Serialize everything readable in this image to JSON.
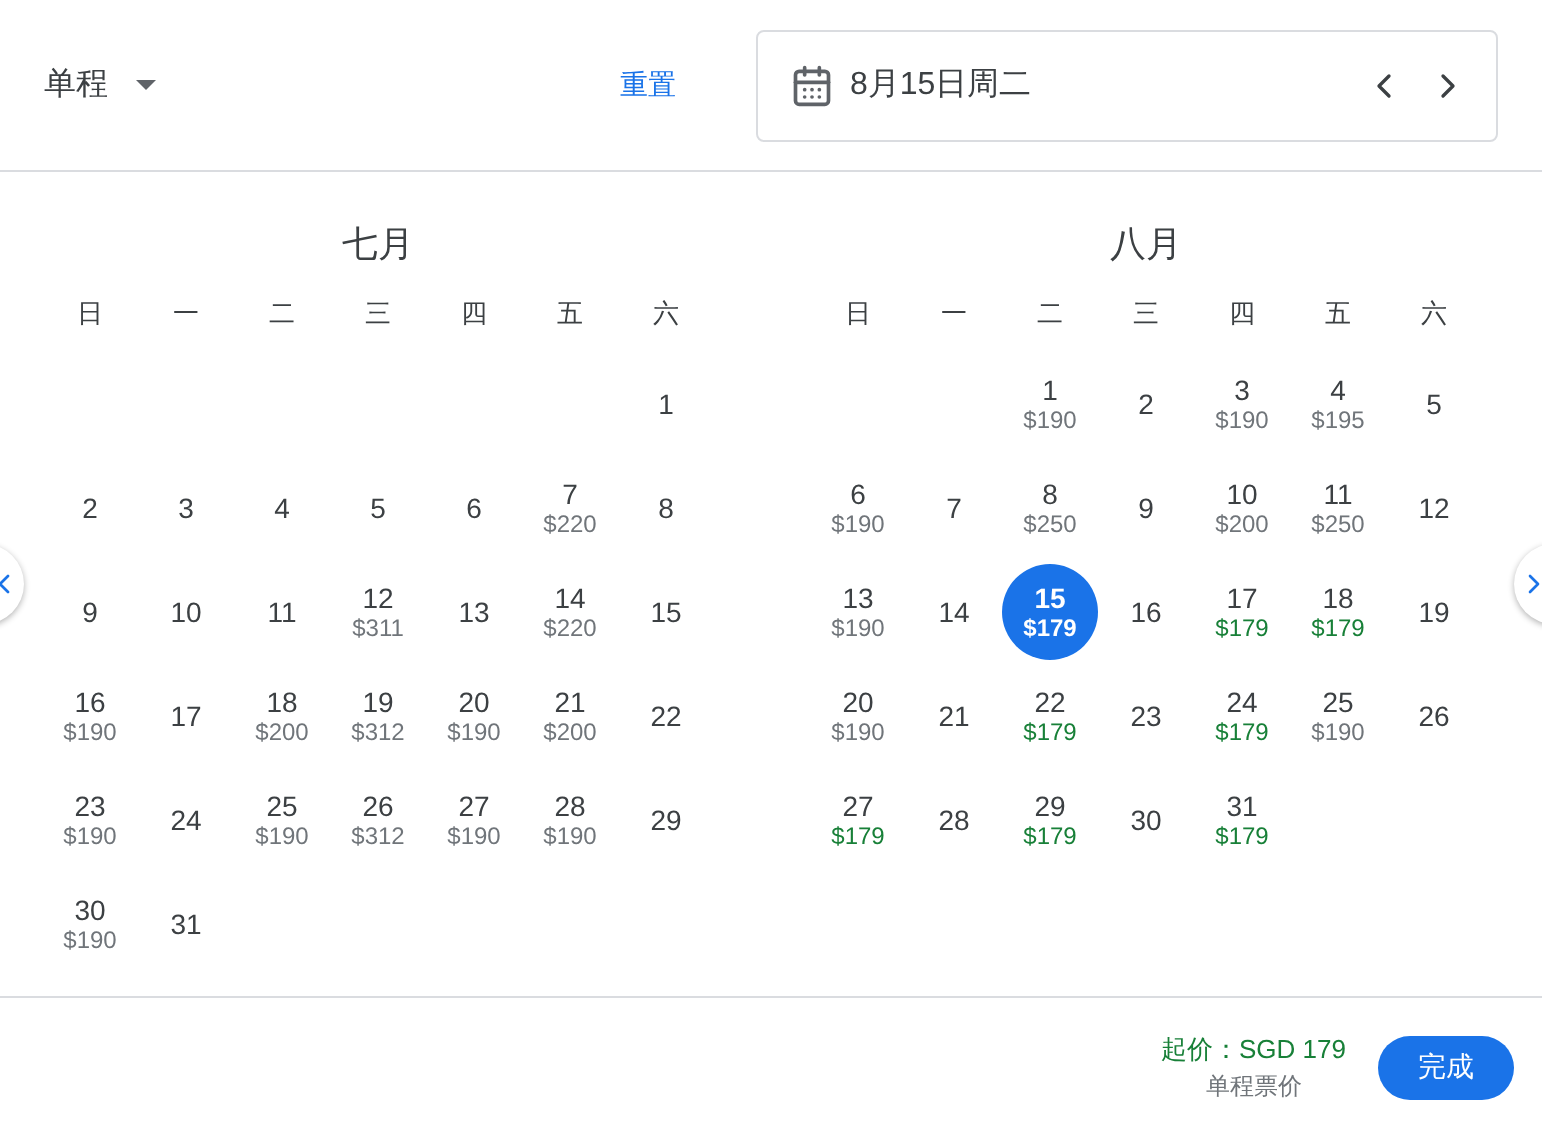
{
  "header": {
    "trip_type": "单程",
    "reset": "重置",
    "date_field": {
      "value": "8月15日周二"
    }
  },
  "months": [
    {
      "title": "七月",
      "weekdays": [
        "日",
        "一",
        "二",
        "三",
        "四",
        "五",
        "六"
      ],
      "weeks": [
        [
          {
            "kind": "blank"
          },
          {
            "kind": "blank"
          },
          {
            "kind": "blank"
          },
          {
            "kind": "blank"
          },
          {
            "kind": "blank"
          },
          {
            "kind": "blank"
          },
          {
            "kind": "day",
            "day": "1",
            "selected": false
          }
        ],
        [
          {
            "kind": "day",
            "day": "2",
            "selected": false
          },
          {
            "kind": "day",
            "day": "3",
            "selected": false
          },
          {
            "kind": "day",
            "day": "4",
            "selected": false
          },
          {
            "kind": "day",
            "day": "5",
            "selected": false
          },
          {
            "kind": "day",
            "day": "6",
            "selected": false
          },
          {
            "kind": "day",
            "day": "7",
            "price": "$220",
            "lowest": false,
            "selected": false
          },
          {
            "kind": "day",
            "day": "8",
            "selected": false
          }
        ],
        [
          {
            "kind": "day",
            "day": "9",
            "selected": false
          },
          {
            "kind": "day",
            "day": "10",
            "selected": false
          },
          {
            "kind": "day",
            "day": "11",
            "selected": false
          },
          {
            "kind": "day",
            "day": "12",
            "price": "$311",
            "lowest": false,
            "selected": false
          },
          {
            "kind": "day",
            "day": "13",
            "selected": false
          },
          {
            "kind": "day",
            "day": "14",
            "price": "$220",
            "lowest": false,
            "selected": false
          },
          {
            "kind": "day",
            "day": "15",
            "selected": false
          }
        ],
        [
          {
            "kind": "day",
            "day": "16",
            "price": "$190",
            "lowest": false,
            "selected": false
          },
          {
            "kind": "day",
            "day": "17",
            "selected": false
          },
          {
            "kind": "day",
            "day": "18",
            "price": "$200",
            "lowest": false,
            "selected": false
          },
          {
            "kind": "day",
            "day": "19",
            "price": "$312",
            "lowest": false,
            "selected": false
          },
          {
            "kind": "day",
            "day": "20",
            "price": "$190",
            "lowest": false,
            "selected": false
          },
          {
            "kind": "day",
            "day": "21",
            "price": "$200",
            "lowest": false,
            "selected": false
          },
          {
            "kind": "day",
            "day": "22",
            "selected": false
          }
        ],
        [
          {
            "kind": "day",
            "day": "23",
            "price": "$190",
            "lowest": false,
            "selected": false
          },
          {
            "kind": "day",
            "day": "24",
            "selected": false
          },
          {
            "kind": "day",
            "day": "25",
            "price": "$190",
            "lowest": false,
            "selected": false
          },
          {
            "kind": "day",
            "day": "26",
            "price": "$312",
            "lowest": false,
            "selected": false
          },
          {
            "kind": "day",
            "day": "27",
            "price": "$190",
            "lowest": false,
            "selected": false
          },
          {
            "kind": "day",
            "day": "28",
            "price": "$190",
            "lowest": false,
            "selected": false
          },
          {
            "kind": "day",
            "day": "29",
            "selected": false
          }
        ],
        [
          {
            "kind": "day",
            "day": "30",
            "price": "$190",
            "lowest": false,
            "selected": false
          },
          {
            "kind": "day",
            "day": "31",
            "selected": false
          }
        ]
      ]
    },
    {
      "title": "八月",
      "weekdays": [
        "日",
        "一",
        "二",
        "三",
        "四",
        "五",
        "六"
      ],
      "weeks": [
        [
          {
            "kind": "blank"
          },
          {
            "kind": "blank"
          },
          {
            "kind": "day",
            "day": "1",
            "price": "$190",
            "lowest": false,
            "selected": false
          },
          {
            "kind": "day",
            "day": "2",
            "selected": false
          },
          {
            "kind": "day",
            "day": "3",
            "price": "$190",
            "lowest": false,
            "selected": false
          },
          {
            "kind": "day",
            "day": "4",
            "price": "$195",
            "lowest": false,
            "selected": false
          },
          {
            "kind": "day",
            "day": "5",
            "selected": false
          }
        ],
        [
          {
            "kind": "day",
            "day": "6",
            "price": "$190",
            "lowest": false,
            "selected": false
          },
          {
            "kind": "day",
            "day": "7",
            "selected": false
          },
          {
            "kind": "day",
            "day": "8",
            "price": "$250",
            "lowest": false,
            "selected": false
          },
          {
            "kind": "day",
            "day": "9",
            "selected": false
          },
          {
            "kind": "day",
            "day": "10",
            "price": "$200",
            "lowest": false,
            "selected": false
          },
          {
            "kind": "day",
            "day": "11",
            "price": "$250",
            "lowest": false,
            "selected": false
          },
          {
            "kind": "day",
            "day": "12",
            "selected": false
          }
        ],
        [
          {
            "kind": "day",
            "day": "13",
            "price": "$190",
            "lowest": false,
            "selected": false
          },
          {
            "kind": "day",
            "day": "14",
            "selected": false
          },
          {
            "kind": "day",
            "day": "15",
            "price": "$179",
            "selected": true
          },
          {
            "kind": "day",
            "day": "16",
            "selected": false
          },
          {
            "kind": "day",
            "day": "17",
            "price": "$179",
            "lowest": true,
            "selected": false
          },
          {
            "kind": "day",
            "day": "18",
            "price": "$179",
            "lowest": true,
            "selected": false
          },
          {
            "kind": "day",
            "day": "19",
            "selected": false
          }
        ],
        [
          {
            "kind": "day",
            "day": "20",
            "price": "$190",
            "lowest": false,
            "selected": false
          },
          {
            "kind": "day",
            "day": "21",
            "selected": false
          },
          {
            "kind": "day",
            "day": "22",
            "price": "$179",
            "lowest": true,
            "selected": false
          },
          {
            "kind": "day",
            "day": "23",
            "selected": false
          },
          {
            "kind": "day",
            "day": "24",
            "price": "$179",
            "lowest": true,
            "selected": false
          },
          {
            "kind": "day",
            "day": "25",
            "price": "$190",
            "lowest": false,
            "selected": false
          },
          {
            "kind": "day",
            "day": "26",
            "selected": false
          }
        ],
        [
          {
            "kind": "day",
            "day": "27",
            "price": "$179",
            "lowest": true,
            "selected": false
          },
          {
            "kind": "day",
            "day": "28",
            "selected": false
          },
          {
            "kind": "day",
            "day": "29",
            "price": "$179",
            "lowest": true,
            "selected": false
          },
          {
            "kind": "day",
            "day": "30",
            "selected": false
          },
          {
            "kind": "day",
            "day": "31",
            "price": "$179",
            "lowest": true,
            "selected": false
          }
        ]
      ]
    }
  ],
  "footer": {
    "price_from": "起价：SGD 179",
    "price_note": "单程票价",
    "done_button": "完成"
  }
}
